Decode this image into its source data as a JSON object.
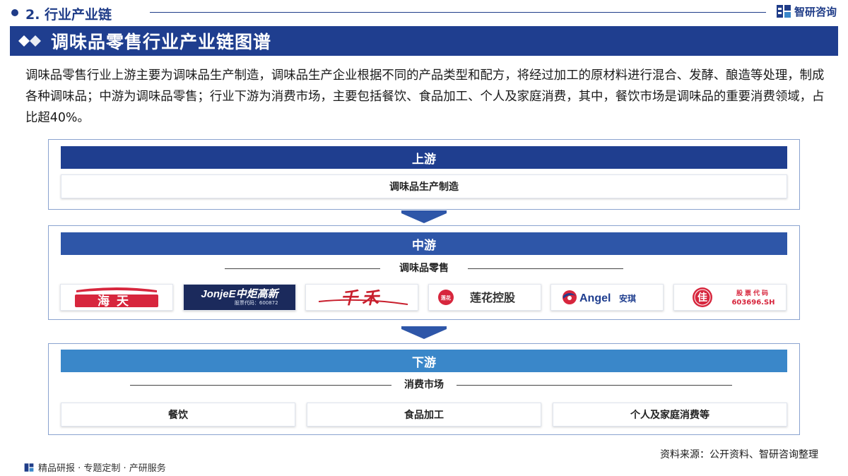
{
  "header": {
    "section_title": "2. 行业产业链",
    "brand_name": "智研咨询"
  },
  "banner": {
    "title": "调味品零售行业产业链图谱"
  },
  "intro_text": "调味品零售行业上游主要为调味品生产制造，调味品生产企业根据不同的产品类型和配方，将经过加工的原材料进行混合、发酵、酿造等处理，制成各种调味品；中游为调味品零售；行业下游为消费市场，主要包括餐饮、食品加工、个人及家庭消费，其中，餐饮市场是调味品的重要消费领域，占比超40%。",
  "upstream": {
    "title": "上游",
    "item": "调味品生产制造"
  },
  "midstream": {
    "title": "中游",
    "sub_label": "调味品零售",
    "logos": [
      {
        "name": "haitian",
        "text": "海天"
      },
      {
        "name": "jonjee",
        "text": "JonjeE中炬高新",
        "sub": "股票代码：600872"
      },
      {
        "name": "qianhe",
        "text": "千禾"
      },
      {
        "name": "lianhua",
        "text": "莲花控股",
        "seal": "莲花"
      },
      {
        "name": "angel",
        "text": "Angel",
        "cn": "安琪"
      },
      {
        "name": "jialong",
        "seal": "佳",
        "text": "股票代码",
        "sub": "603696.SH"
      }
    ]
  },
  "downstream": {
    "title": "下游",
    "sub_label": "消费市场",
    "items": [
      "餐饮",
      "食品加工",
      "个人及家庭消费等"
    ]
  },
  "footer": {
    "source": "资料来源：公开资料、智研咨询整理",
    "tagline": "精品研报 · 专题定制 · 产研服务"
  },
  "colors": {
    "navy": "#1f3e8f",
    "mid_blue": "#2e56a8",
    "light_blue": "#3a87c9",
    "logo_red": "#d7263d"
  }
}
